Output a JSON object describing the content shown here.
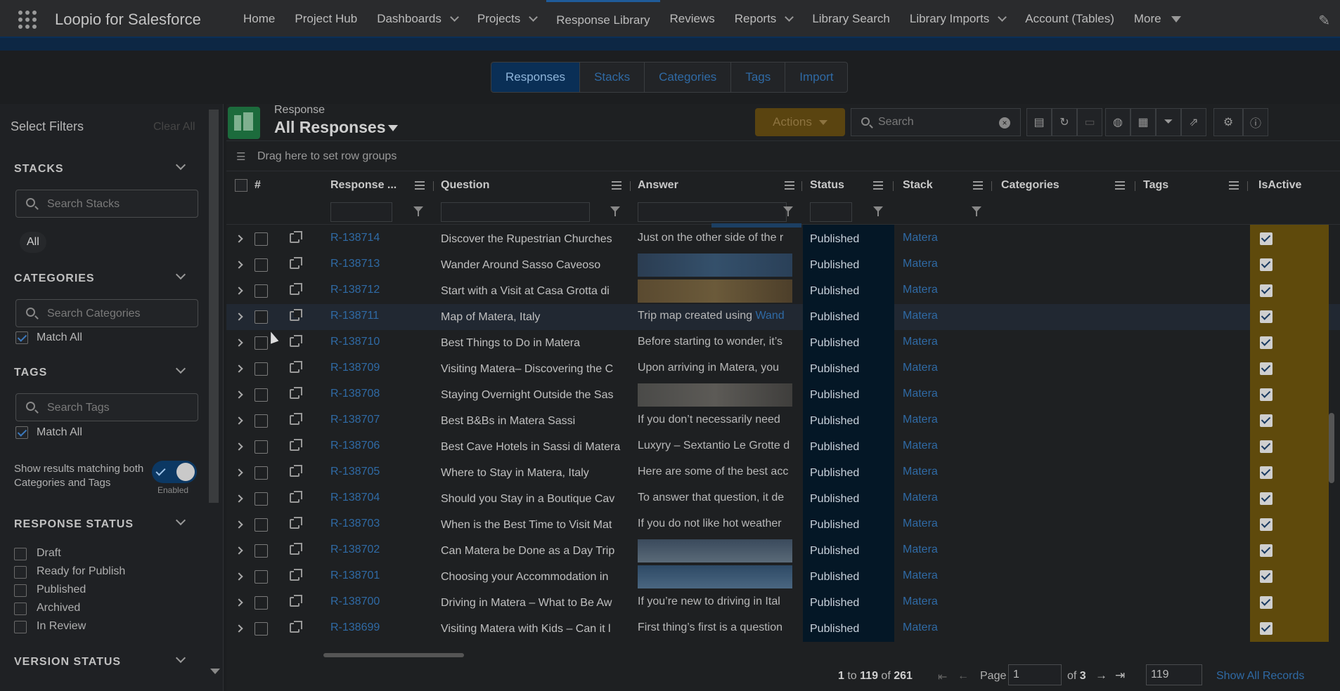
{
  "app": {
    "name": "Loopio for Salesforce"
  },
  "nav": [
    {
      "label": "Home",
      "dropdown": false
    },
    {
      "label": "Project Hub",
      "dropdown": false
    },
    {
      "label": "Dashboards",
      "dropdown": true
    },
    {
      "label": "Projects",
      "dropdown": true
    },
    {
      "label": "Response Library",
      "dropdown": false,
      "active": true
    },
    {
      "label": "Reviews",
      "dropdown": false
    },
    {
      "label": "Reports",
      "dropdown": true
    },
    {
      "label": "Library Search",
      "dropdown": false
    },
    {
      "label": "Library Imports",
      "dropdown": true
    },
    {
      "label": "Account (Tables)",
      "dropdown": false
    },
    {
      "label": "More",
      "dropdown": "triangle"
    }
  ],
  "tabs": [
    "Responses",
    "Stacks",
    "Categories",
    "Tags",
    "Import"
  ],
  "sidebar": {
    "title": "Select Filters",
    "clear_all": "Clear All",
    "stacks": {
      "title": "STACKS",
      "placeholder": "Search Stacks",
      "pill": "All"
    },
    "categories": {
      "title": "CATEGORIES",
      "placeholder": "Search Categories",
      "match_all": "Match All"
    },
    "tags": {
      "title": "TAGS",
      "placeholder": "Search Tags",
      "match_all": "Match All"
    },
    "toggle": {
      "text": "Show results matching both Categories and Tags",
      "sub": "Enabled"
    },
    "response_status": {
      "title": "RESPONSE STATUS",
      "items": [
        "Draft",
        "Ready for Publish",
        "Published",
        "Archived",
        "In Review"
      ]
    },
    "version_status": {
      "title": "VERSION STATUS"
    }
  },
  "header": {
    "object_label": "Response",
    "title": "All Responses",
    "actions": "Actions",
    "search_placeholder": "Search",
    "row_groups": "Drag here to set row groups"
  },
  "columns": {
    "num": "#",
    "response": "Response ...",
    "question": "Question",
    "answer": "Answer",
    "status": "Status",
    "stack": "Stack",
    "categories": "Categories",
    "tags": "Tags",
    "isactive": "IsActive"
  },
  "rows": [
    {
      "id": "R-138714",
      "question": "Discover the Rupestrian Churches",
      "answer": "Just on the other side of the r",
      "answer_type": "text",
      "status": "Published",
      "stack": "Matera"
    },
    {
      "id": "R-138713",
      "question": "Wander Around Sasso Caveoso",
      "answer": "",
      "answer_type": "image-blue",
      "status": "Published",
      "stack": "Matera"
    },
    {
      "id": "R-138712",
      "question": "Start with a Visit at Casa Grotta di",
      "answer": "",
      "answer_type": "image-brown",
      "status": "Published",
      "stack": "Matera"
    },
    {
      "id": "R-138711",
      "question": "Map of Matera, Italy",
      "answer": "Trip map created using ",
      "answer_link": "Wand",
      "answer_type": "text",
      "status": "Published",
      "stack": "Matera",
      "highlight": true
    },
    {
      "id": "R-138710",
      "question": "Best Things to Do in Matera",
      "answer": "Before starting to wonder, it’s",
      "answer_type": "text",
      "status": "Published",
      "stack": "Matera"
    },
    {
      "id": "R-138709",
      "question": "Visiting Matera– Discovering the C",
      "answer": "Upon arriving in Matera, you",
      "answer_type": "text",
      "status": "Published",
      "stack": "Matera"
    },
    {
      "id": "R-138708",
      "question": "Staying Overnight Outside the Sas",
      "answer": "",
      "answer_type": "image-gray",
      "status": "Published",
      "stack": "Matera"
    },
    {
      "id": "R-138707",
      "question": "Best B&Bs in Matera Sassi",
      "answer": "If you don’t necessarily need",
      "answer_type": "text",
      "status": "Published",
      "stack": "Matera"
    },
    {
      "id": "R-138706",
      "question": "Best Cave Hotels in Sassi di Matera",
      "answer": "Luxyry – Sextantio Le Grotte d",
      "answer_type": "text",
      "status": "Published",
      "stack": "Matera"
    },
    {
      "id": "R-138705",
      "question": "Where to Stay in Matera, Italy",
      "answer": "Here are some of the best acc",
      "answer_type": "text",
      "status": "Published",
      "stack": "Matera"
    },
    {
      "id": "R-138704",
      "question": "Should you Stay in a Boutique Cav",
      "answer": "To answer that question, it de",
      "answer_type": "text",
      "status": "Published",
      "stack": "Matera"
    },
    {
      "id": "R-138703",
      "question": "When is the Best Time to Visit Mat",
      "answer": "If you do not like hot weather",
      "answer_type": "text",
      "status": "Published",
      "stack": "Matera"
    },
    {
      "id": "R-138702",
      "question": "Can Matera be Done as a Day Trip",
      "answer": "",
      "answer_type": "image-sky",
      "status": "Published",
      "stack": "Matera"
    },
    {
      "id": "R-138701",
      "question": "Choosing your Accommodation in",
      "answer": "",
      "answer_type": "image-sky2",
      "status": "Published",
      "stack": "Matera"
    },
    {
      "id": "R-138700",
      "question": "Driving in Matera – What to Be Aw",
      "answer": "If you’re new to driving in Ital",
      "answer_type": "text",
      "status": "Published",
      "stack": "Matera"
    },
    {
      "id": "R-138699",
      "question": "Visiting Matera with Kids – Can it l",
      "answer": "First thing’s first is a question",
      "answer_type": "text",
      "status": "Published",
      "stack": "Matera"
    }
  ],
  "footer": {
    "range_from": "1",
    "to": "to",
    "range_to": "119",
    "of": "of",
    "total": "261",
    "page_label": "Page",
    "page_value": "1",
    "of_pages": "of",
    "pages": "3",
    "page_size": "119",
    "show_all": "Show All Records"
  },
  "colors": {
    "accent": "#1f5b99",
    "status_bg": "#041726",
    "active_bg": "#5f4a0c",
    "link": "#2f6aa5"
  }
}
